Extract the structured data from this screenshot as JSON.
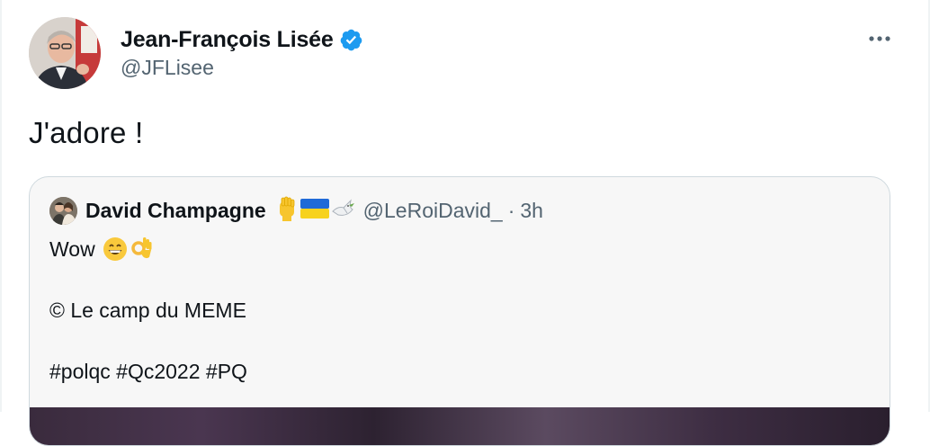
{
  "tweet": {
    "author": {
      "name": "Jean-François Lisée",
      "handle": "@JFLisee",
      "verified": true,
      "avatar_icon": "portrait-avatar"
    },
    "more_icon": "more-dots-icon",
    "text": "J'adore !",
    "quoted": {
      "name": "David Champagne",
      "name_emojis": [
        "raised-fist-icon",
        "ukraine-flag-icon",
        "dove-icon"
      ],
      "handle": "@LeRoiDavid_",
      "separator": "·",
      "time": "3h",
      "lines": {
        "line1": "Wow",
        "line1_emojis": [
          "grinning-face-icon",
          "ok-hand-icon"
        ],
        "line2": "© Le camp du MEME",
        "line3": "#polqc #Qc2022 #PQ"
      }
    }
  },
  "colors": {
    "verified_blue": "#1d9bf0",
    "secondary_text": "#536471",
    "primary_text": "#0f1419",
    "card_border": "#cfd9de",
    "card_bg": "#f7f7f7"
  }
}
